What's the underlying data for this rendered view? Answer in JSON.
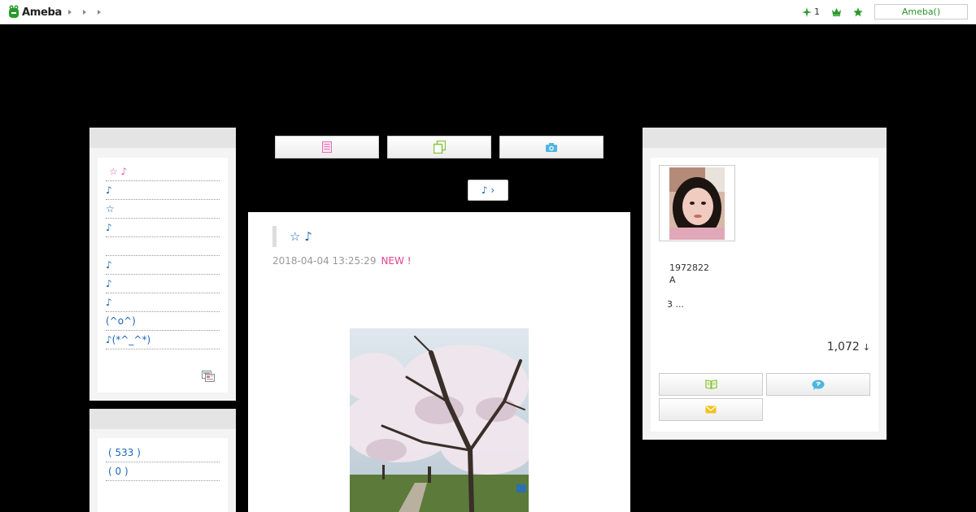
{
  "header": {
    "logo_text": "Ameba",
    "points_count": "1",
    "user_button_label": "Ameba()",
    "icons": [
      "plus-star-icon",
      "crown-icon",
      "star-icon"
    ],
    "brand_color": "#2a9b2a"
  },
  "left_menu": {
    "items": [
      {
        "label": "☆ ♪",
        "accent": "pink"
      },
      {
        "label": "♪"
      },
      {
        "label": "☆"
      },
      {
        "label": "♪"
      },
      {
        "label": ""
      },
      {
        "label": "♪"
      },
      {
        "label": "♪"
      },
      {
        "label": "♪"
      },
      {
        "label": "(^o^)"
      },
      {
        "label": "♪(*^_^*)"
      }
    ],
    "rss_icon": "feed-icon"
  },
  "left_counts": {
    "items": [
      {
        "label": "( 533 )"
      },
      {
        "label": "( 0 )"
      }
    ]
  },
  "tabs": [
    {
      "icon": "document-icon",
      "color": "#e56fb8"
    },
    {
      "icon": "copy-pages-icon",
      "color": "#8ac43f"
    },
    {
      "icon": "camera-icon",
      "color": "#4fb6de"
    }
  ],
  "nav": {
    "next_label": "♪ ›"
  },
  "article": {
    "title": "☆ ♪",
    "datetime": "2018-04-04 13:25:29",
    "new_badge": "NEW !",
    "accent_color": "#1a67b5",
    "new_color": "#e0418f"
  },
  "profile": {
    "line1": "1972822",
    "line2": "A",
    "line3": "3 ...",
    "followers": "1,072",
    "followers_arrow": "↓",
    "buttons": [
      {
        "icon": "book-icon",
        "color": "#8ac43f"
      },
      {
        "icon": "chat-bubble-icon",
        "color": "#4fb6de"
      },
      {
        "icon": "envelope-icon",
        "color": "#f2c21b"
      }
    ]
  }
}
